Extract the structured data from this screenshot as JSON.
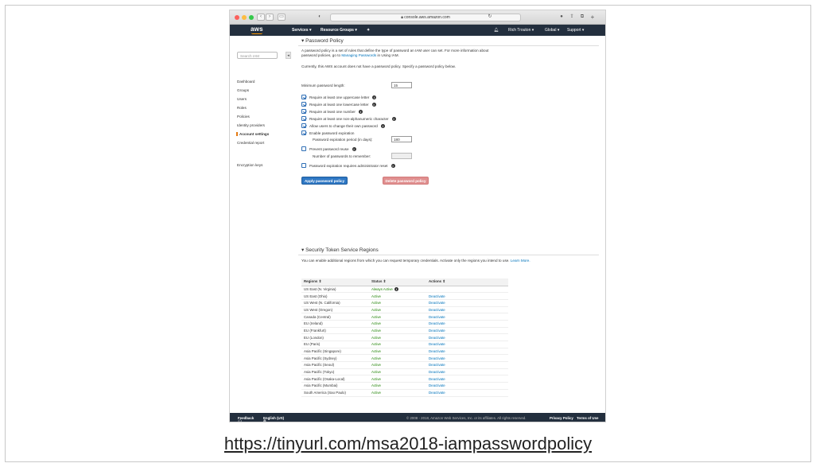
{
  "browser": {
    "url": "console.aws.amazon.com"
  },
  "awsnav": {
    "logo": "aws",
    "services": "Services",
    "resource_groups": "Resource Groups",
    "user": "Rich Trouton",
    "region": "Global",
    "support": "Support"
  },
  "sidebar": {
    "search_placeholder": "Search IAM",
    "items": [
      "Dashboard",
      "Groups",
      "Users",
      "Roles",
      "Policies",
      "Identity providers",
      "Account settings",
      "Credential report",
      "Encryption keys"
    ],
    "active": "Account settings"
  },
  "password_policy": {
    "title": "Password Policy",
    "intro_1": "A password policy is a set of rules that define the type of password an IAM user can set. For more information about password policies, go to",
    "intro_link": "Managing Passwords",
    "intro_2": "in Using IAM.",
    "current": "Currently, this AWS account does not have a password policy. Specify a password policy below.",
    "min_length_label": "Minimum password length:",
    "min_length_value": "15",
    "options": [
      {
        "label": "Require at least one uppercase letter",
        "checked": true
      },
      {
        "label": "Require at least one lowercase letter",
        "checked": true
      },
      {
        "label": "Require at least one number",
        "checked": true
      },
      {
        "label": "Require at least one non-alphanumeric character",
        "checked": true
      },
      {
        "label": "Allow users to change their own password",
        "checked": true
      },
      {
        "label": "Enable password expiration",
        "checked": true
      }
    ],
    "expiration_label": "Password expiration period (in days):",
    "expiration_value": "180",
    "reuse_label": "Prevent password reuse",
    "reuse_checked": false,
    "remember_label": "Number of passwords to remember:",
    "admin_reset_label": "Password expiration requires administrator reset",
    "admin_reset_checked": false,
    "apply_button": "Apply password policy",
    "delete_button": "Delete password policy"
  },
  "sts": {
    "title": "Security Token Service Regions",
    "intro": "You can enable additional regions from which you can request temporary credentials. Activate only the regions you intend to use.",
    "learn_more": "Learn More.",
    "columns": [
      "Regions",
      "Status",
      "Actions"
    ],
    "rows": [
      {
        "region": "US East (N. Virginia)",
        "status": "Always Active",
        "action": ""
      },
      {
        "region": "US East (Ohio)",
        "status": "Active",
        "action": "Deactivate"
      },
      {
        "region": "US West (N. California)",
        "status": "Active",
        "action": "Deactivate"
      },
      {
        "region": "US West (Oregon)",
        "status": "Active",
        "action": "Deactivate"
      },
      {
        "region": "Canada (Central)",
        "status": "Active",
        "action": "Deactivate"
      },
      {
        "region": "EU (Ireland)",
        "status": "Active",
        "action": "Deactivate"
      },
      {
        "region": "EU (Frankfurt)",
        "status": "Active",
        "action": "Deactivate"
      },
      {
        "region": "EU (London)",
        "status": "Active",
        "action": "Deactivate"
      },
      {
        "region": "EU (Paris)",
        "status": "Active",
        "action": "Deactivate"
      },
      {
        "region": "Asia Pacific (Singapore)",
        "status": "Active",
        "action": "Deactivate"
      },
      {
        "region": "Asia Pacific (Sydney)",
        "status": "Active",
        "action": "Deactivate"
      },
      {
        "region": "Asia Pacific (Seoul)",
        "status": "Active",
        "action": "Deactivate"
      },
      {
        "region": "Asia Pacific (Tokyo)",
        "status": "Active",
        "action": "Deactivate"
      },
      {
        "region": "Asia Pacific (Osaka-Local)",
        "status": "Active",
        "action": "Deactivate"
      },
      {
        "region": "Asia Pacific (Mumbai)",
        "status": "Active",
        "action": "Deactivate"
      },
      {
        "region": "South America (Sao Paulo)",
        "status": "Active",
        "action": "Deactivate"
      }
    ]
  },
  "footer": {
    "feedback": "Feedback",
    "language": "English (US)",
    "copyright": "© 2008 - 2018, Amazon Web Services, Inc. or its affiliates. All rights reserved.",
    "privacy": "Privacy Policy",
    "terms": "Terms of Use"
  },
  "caption": "https://tinyurl.com/msa2018-iampasswordpolicy",
  "colors": {
    "aws_nav": "#232f3e",
    "accent": "#ff9900",
    "link": "#0073bb",
    "active_green": "#1d8102",
    "primary_button": "#2f78c4",
    "danger_button": "#e08f8f"
  }
}
